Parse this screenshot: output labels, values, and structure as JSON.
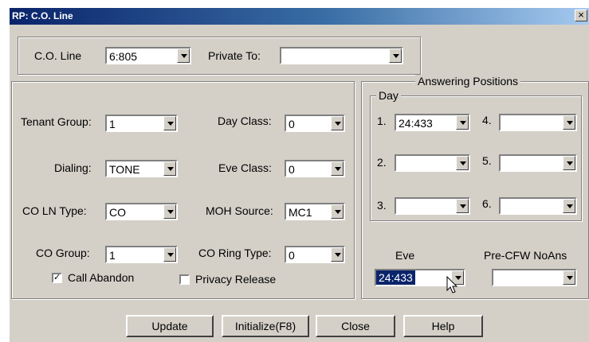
{
  "window": {
    "title": "RP: C.O. Line",
    "close_glyph": "×"
  },
  "top": {
    "co_line_label": "C.O. Line",
    "co_line_value": "6:805",
    "private_to_label": "Private To:",
    "private_to_value": ""
  },
  "left": {
    "tenant_group_label": "Tenant Group:",
    "tenant_group_value": "1",
    "day_class_label": "Day Class:",
    "day_class_value": "0",
    "dialing_label": "Dialing:",
    "dialing_value": "TONE",
    "eve_class_label": "Eve Class:",
    "eve_class_value": "0",
    "co_ln_type_label": "CO LN Type:",
    "co_ln_type_value": "CO",
    "moh_source_label": "MOH Source:",
    "moh_source_value": "MC1",
    "co_group_label": "CO Group:",
    "co_group_value": "1",
    "co_ring_type_label": "CO Ring Type:",
    "co_ring_type_value": "0",
    "call_abandon_label": "Call Abandon",
    "call_abandon_checked": true,
    "privacy_release_label": "Privacy Release",
    "privacy_release_checked": false
  },
  "answering": {
    "title": "Answering Positions",
    "day_title": "Day",
    "day": [
      {
        "num": "1.",
        "value": "24:433"
      },
      {
        "num": "4.",
        "value": ""
      },
      {
        "num": "2.",
        "value": ""
      },
      {
        "num": "5.",
        "value": ""
      },
      {
        "num": "3.",
        "value": ""
      },
      {
        "num": "6.",
        "value": ""
      }
    ],
    "eve_label": "Eve",
    "eve_value": "24:433",
    "pre_cfw_label": "Pre-CFW NoAns",
    "pre_cfw_value": ""
  },
  "buttons": {
    "update": "Update",
    "initialize": "Initialize(F8)",
    "close": "Close",
    "help": "Help"
  },
  "icons": {
    "dropdown": "chevron-down-icon",
    "cursor": "mouse-pointer-icon",
    "check": "checkmark-icon"
  }
}
